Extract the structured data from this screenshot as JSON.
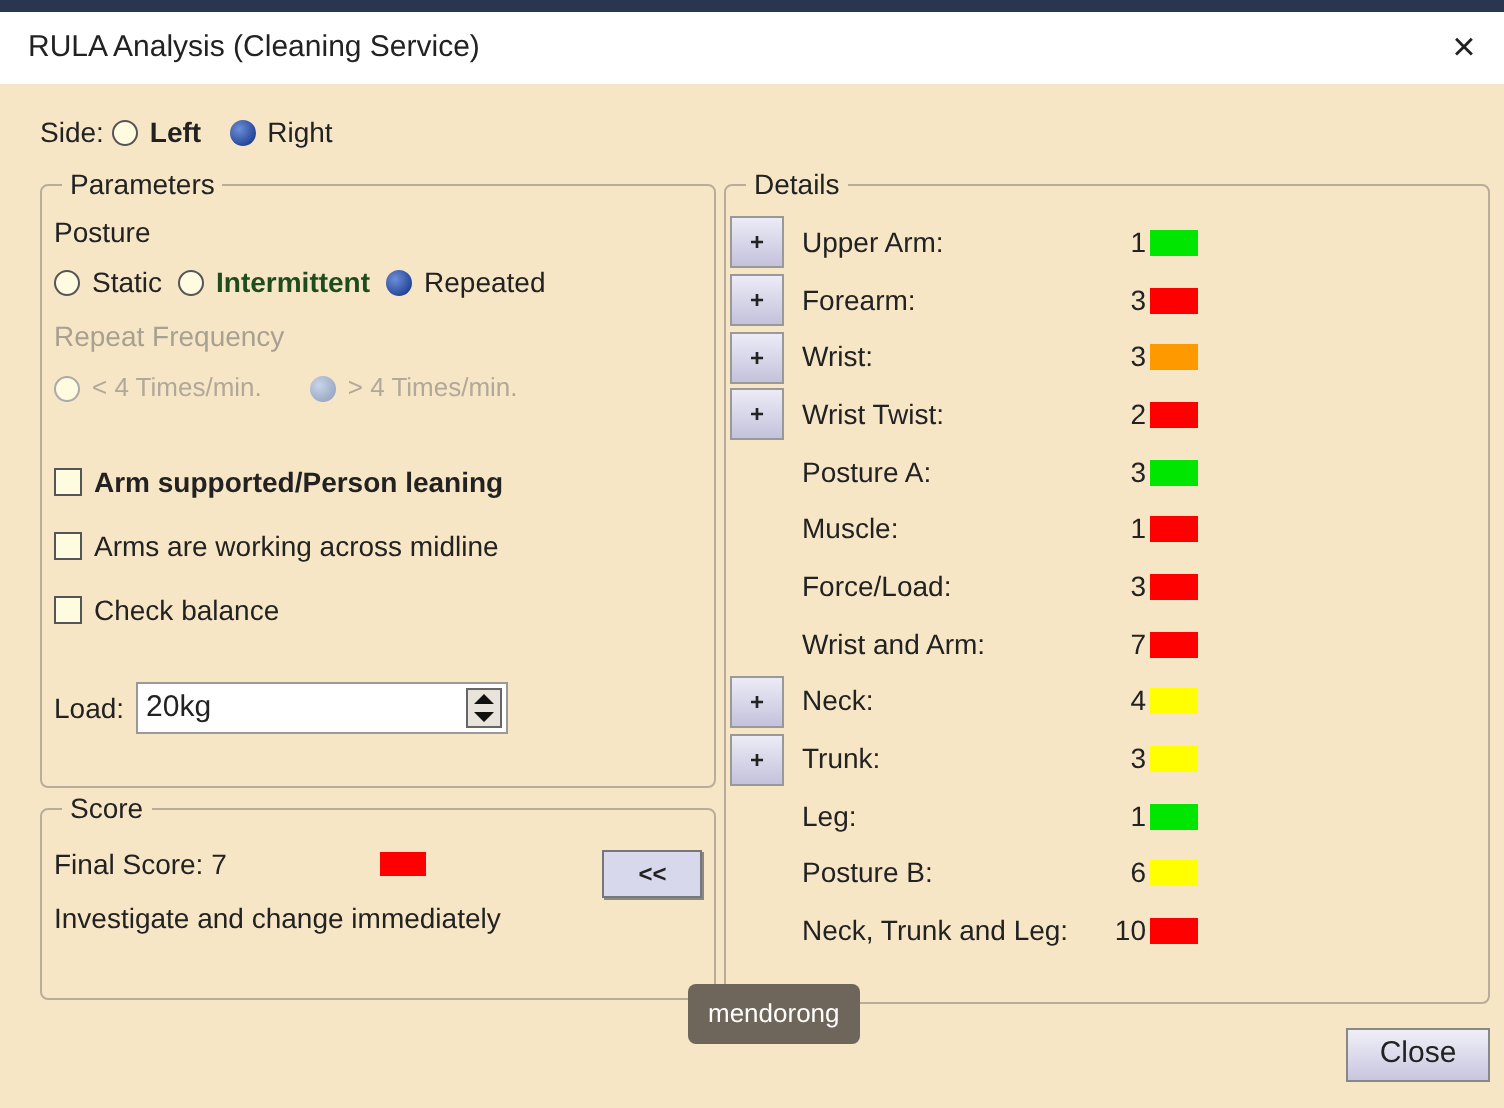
{
  "window": {
    "title": "RULA Analysis (Cleaning Service)",
    "close": "×"
  },
  "side": {
    "label": "Side:",
    "options": [
      {
        "label": "Left",
        "selected": false,
        "emphasized": true
      },
      {
        "label": "Right",
        "selected": true,
        "emphasized": false
      }
    ]
  },
  "parameters": {
    "title": "Parameters",
    "posture_label": "Posture",
    "posture_options": [
      {
        "label": "Static",
        "selected": false,
        "emphasized": false,
        "color": "#222222"
      },
      {
        "label": "Intermittent",
        "selected": false,
        "emphasized": true,
        "color": "#1d4d1d"
      },
      {
        "label": "Repeated",
        "selected": true,
        "emphasized": false,
        "color": "#222222"
      }
    ],
    "frequency_label": "Repeat Frequency",
    "frequency_disabled": true,
    "frequency_options": [
      {
        "label": "< 4 Times/min.",
        "selected": false
      },
      {
        "label": "> 4 Times/min.",
        "selected": true
      }
    ],
    "checkboxes": [
      {
        "label": "Arm supported/Person leaning",
        "checked": false,
        "emphasized": true
      },
      {
        "label": "Arms are working across midline",
        "checked": false,
        "emphasized": false
      },
      {
        "label": "Check balance",
        "checked": false,
        "emphasized": false
      }
    ],
    "load": {
      "label": "Load:",
      "value": "20kg"
    }
  },
  "score": {
    "title": "Score",
    "final": "Final Score: 7",
    "color": "#ff0000",
    "message": "Investigate and change immediately",
    "collapse_button": "<<"
  },
  "details": {
    "title": "Details",
    "rows": [
      {
        "expandable": true,
        "button": "+",
        "label": "Upper Arm:",
        "value": "1",
        "color": "#00e600"
      },
      {
        "expandable": true,
        "button": "+",
        "label": "Forearm:",
        "value": "3",
        "color": "#ff0000"
      },
      {
        "expandable": true,
        "button": "+",
        "label": "Wrist:",
        "value": "3",
        "color": "#ff9900"
      },
      {
        "expandable": true,
        "button": "+",
        "label": "Wrist Twist:",
        "value": "2",
        "color": "#ff0000"
      },
      {
        "expandable": false,
        "label": "Posture A:",
        "value": "3",
        "color": "#00e600"
      },
      {
        "expandable": false,
        "label": "Muscle:",
        "value": "1",
        "color": "#ff0000"
      },
      {
        "expandable": false,
        "label": "Force/Load:",
        "value": "3",
        "color": "#ff0000"
      },
      {
        "expandable": false,
        "label": "Wrist and Arm:",
        "value": "7",
        "color": "#ff0000"
      },
      {
        "expandable": true,
        "button": "+",
        "label": "Neck:",
        "value": "4",
        "color": "#ffff00"
      },
      {
        "expandable": true,
        "button": "+",
        "label": "Trunk:",
        "value": "3",
        "color": "#ffff00"
      },
      {
        "expandable": false,
        "label": "Leg:",
        "value": "1",
        "color": "#00e600"
      },
      {
        "expandable": false,
        "label": "Posture B:",
        "value": "6",
        "color": "#ffff00"
      },
      {
        "expandable": false,
        "label": "Neck, Trunk and Leg:",
        "value": "10",
        "color": "#ff0000"
      }
    ]
  },
  "tooltip": "mendorong",
  "buttons": [
    "Close"
  ]
}
